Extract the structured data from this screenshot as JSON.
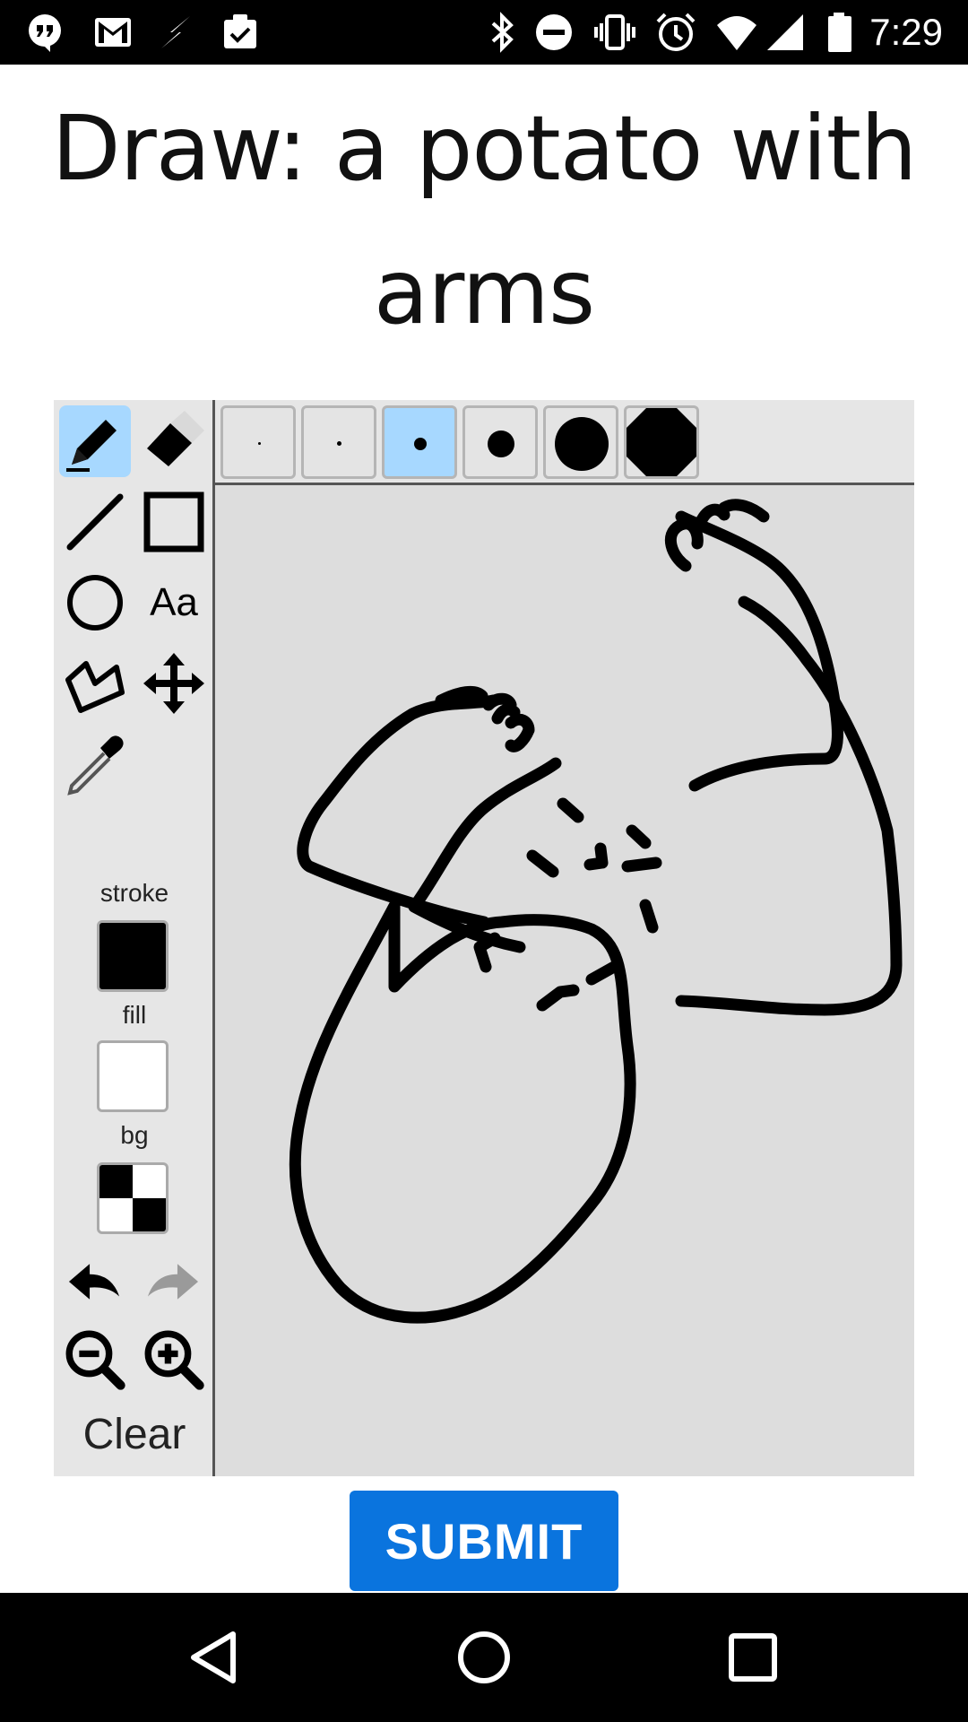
{
  "status_bar": {
    "time": "7:29",
    "left_icons": [
      "hangouts-icon",
      "gmail-icon",
      "flash-icon",
      "clipboard-check-icon"
    ],
    "right_icons": [
      "bluetooth-icon",
      "do-not-disturb-icon",
      "vibrate-icon",
      "alarm-icon",
      "wifi-icon",
      "signal-icon",
      "battery-icon"
    ]
  },
  "prompt": {
    "text": "Draw: a potato with arms"
  },
  "toolbox": {
    "tools": [
      "pencil-icon",
      "eraser-icon",
      "line-icon",
      "rectangle-icon",
      "ellipse-icon",
      "text-icon",
      "polygon-icon",
      "move-icon",
      "eyedropper-icon"
    ],
    "active_tool": "pencil",
    "text_tool_label": "Aa",
    "stroke_label": "stroke",
    "fill_label": "fill",
    "bg_label": "bg",
    "stroke_color": "#000000",
    "fill_color": "#ffffff",
    "bg_color": "transparent",
    "history": [
      "undo-icon",
      "redo-icon"
    ],
    "zoom": [
      "zoom-out-icon",
      "zoom-in-icon"
    ],
    "clear_label": "Clear"
  },
  "brush_sizes": {
    "count": 6,
    "selected_index": 2
  },
  "canvas": {
    "background": "#dddddd",
    "stroke_color": "#000000"
  },
  "submit": {
    "label": "SUBMIT"
  },
  "colors": {
    "accent": "#0a74de",
    "active_tool_bg": "#a7d8ff"
  }
}
